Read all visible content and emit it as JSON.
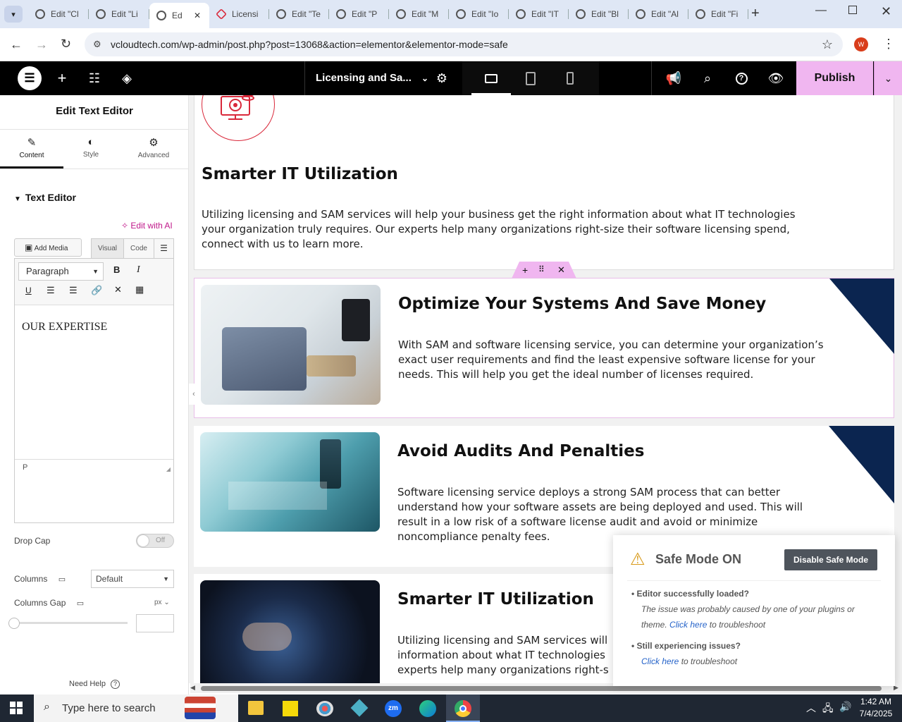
{
  "browser": {
    "tabs": [
      {
        "label": "Edit \"Cl"
      },
      {
        "label": "Edit \"Li"
      },
      {
        "label": "Ed"
      },
      {
        "label": "Licensi"
      },
      {
        "label": "Edit \"Te"
      },
      {
        "label": "Edit \"P"
      },
      {
        "label": "Edit \"M"
      },
      {
        "label": "Edit \"Io"
      },
      {
        "label": "Edit \"IT"
      },
      {
        "label": "Edit \"Bl"
      },
      {
        "label": "Edit \"Al"
      },
      {
        "label": "Edit \"Fi"
      }
    ],
    "url": "vcloudtech.com/wp-admin/post.php?post=13068&action=elementor&elementor-mode=safe",
    "profile_initial": "W"
  },
  "elementor": {
    "page_title": "Licensing and Sa...",
    "publish_label": "Publish"
  },
  "panel": {
    "title": "Edit Text Editor",
    "tabs": [
      {
        "label": "Content"
      },
      {
        "label": "Style"
      },
      {
        "label": "Advanced"
      }
    ],
    "section_title": "Text Editor",
    "edit_ai": "Edit with AI",
    "add_media": "Add Media",
    "visual_tab": "Visual",
    "code_tab": "Code",
    "format_select": "Paragraph",
    "editor_content": "OUR EXPERTISE",
    "path_label": "P",
    "drop_cap_label": "Drop Cap",
    "drop_cap_value": "Off",
    "columns_label": "Columns",
    "columns_value": "Default",
    "columns_gap_label": "Columns Gap",
    "columns_gap_unit": "px",
    "need_help": "Need Help"
  },
  "preview": {
    "block1": {
      "title": "Smarter IT Utilization",
      "text": "Utilizing licensing and SAM services will help your business get the right information about what IT technologies your organization truly requires. Our experts help many organizations right-size their software licensing spend, connect with us to learn more."
    },
    "block2": {
      "title": "Optimize Your Systems And Save Money",
      "text": "With SAM and software licensing service, you can determine your organization’s exact user requirements and find the least expensive software license for your needs. This will help you get the ideal number of licenses required."
    },
    "block3": {
      "title": "Avoid Audits And Penalties",
      "text": "Software licensing service deploys a strong SAM process that can better understand how your software assets are being deployed and used. This will result in a low risk of a software license audit and avoid or minimize noncompliance penalty fees."
    },
    "block4": {
      "title": "Smarter IT Utilization",
      "text_line1": "Utilizing licensing and SAM services will",
      "text_line2": "information about what IT technologies",
      "text_line3": "experts help many organizations right-s"
    }
  },
  "safe_mode": {
    "title": "Safe Mode ON",
    "disable_button": "Disable Safe Mode",
    "item1_heading": "Editor successfully loaded?",
    "item1_text": "The issue was probably caused by one of your plugins or theme.",
    "item1_link": "Click here",
    "item1_suffix": "to troubleshoot",
    "item2_heading": "Still experiencing issues?",
    "item2_link": "Click here",
    "item2_suffix": "to troubleshoot"
  },
  "taskbar": {
    "search_placeholder": "Type here to search",
    "time": "1:42 AM",
    "date": "7/4/2025"
  },
  "colors": {
    "publish_bg": "#f0b6f0",
    "elementor_bar": "#000000",
    "navy_corner": "#0b2550",
    "accent_red": "#d9283a",
    "link_blue": "#2563c9"
  }
}
